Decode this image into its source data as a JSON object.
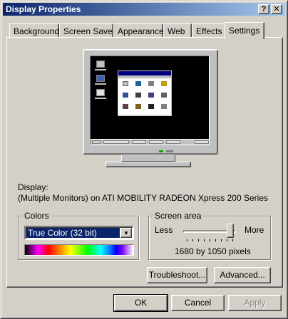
{
  "window": {
    "title": "Display Properties"
  },
  "title_buttons": {
    "help": "?",
    "close": "✕"
  },
  "tabs": [
    {
      "label": "Background"
    },
    {
      "label": "Screen Saver"
    },
    {
      "label": "Appearance"
    },
    {
      "label": "Web"
    },
    {
      "label": "Effects"
    },
    {
      "label": "Settings",
      "active": true
    }
  ],
  "settings": {
    "display_label": "Display:",
    "display_value": "(Multiple Monitors) on ATI MOBILITY RADEON Xpress 200 Series",
    "colors": {
      "legend": "Colors",
      "selected": "True Color (32 bit)"
    },
    "screen_area": {
      "legend": "Screen area",
      "less": "Less",
      "more": "More",
      "resolution": "1680 by 1050 pixels",
      "slider_fraction": 0.95
    },
    "troubleshoot_button": "Troubleshoot...",
    "advanced_button": "Advanced..."
  },
  "footer": {
    "ok": "OK",
    "cancel": "Cancel",
    "apply": "Apply"
  },
  "colors": {
    "titlebar_start": "#0a246a",
    "titlebar_end": "#a6caf0",
    "face": "#d4d0c8",
    "selection": "#0a246a"
  }
}
